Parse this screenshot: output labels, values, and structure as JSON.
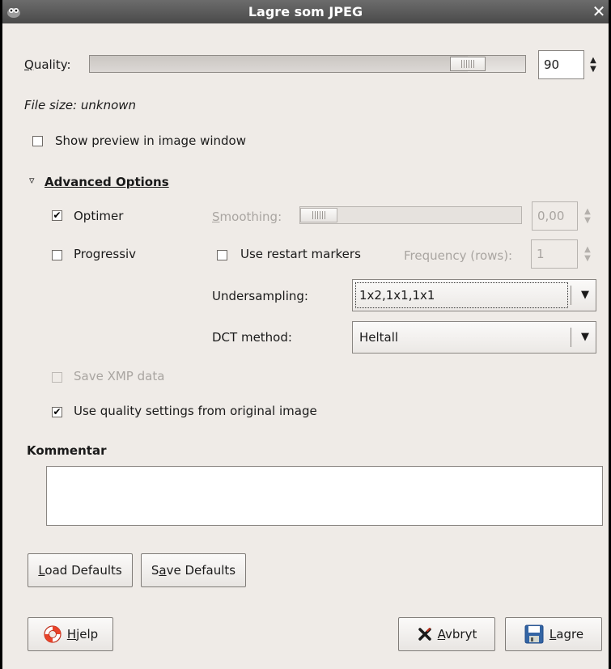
{
  "window": {
    "title": "Lagre som JPEG",
    "close_glyph": "✕"
  },
  "quality": {
    "label_accel": "Q",
    "label_rest": "uality:",
    "value": "90",
    "slider_fraction": 0.9
  },
  "file_size": "File size: unknown",
  "show_preview": {
    "label": "Show preview in image window",
    "checked": false
  },
  "advanced": {
    "expander_glyph": "▿",
    "label_accel": "A",
    "label_rest": "dvanced Options",
    "optimize": {
      "label": "Optimer",
      "checked": true
    },
    "smoothing": {
      "label_accel": "S",
      "label_rest": "moothing:",
      "value": "0,00",
      "slider_fraction": 0.0
    },
    "progressive": {
      "label": "Progressiv",
      "checked": false
    },
    "restart_markers": {
      "label": "Use restart markers",
      "checked": false
    },
    "frequency": {
      "label": "Frequency (rows):",
      "value": "1"
    },
    "undersampling": {
      "label": "Undersampling:",
      "value": "1x2,1x1,1x1"
    },
    "dct": {
      "label": "DCT method:",
      "value": "Heltall"
    },
    "save_xmp": {
      "label": "Save XMP data",
      "checked": false
    },
    "use_quality": {
      "label": "Use quality settings from original image",
      "checked": true
    }
  },
  "comment": {
    "heading": "Kommentar",
    "value": ""
  },
  "buttons": {
    "load_defaults_accel": "L",
    "load_defaults_rest": "oad Defaults",
    "save_defaults_pre": "S",
    "save_defaults_accel": "a",
    "save_defaults_rest": "ve Defaults",
    "help_accel": "H",
    "help_rest": "jelp",
    "cancel_accel": "A",
    "cancel_rest": "vbryt",
    "save_accel": "L",
    "save_rest": "agre"
  },
  "icons": {
    "help": "lifebuoy-icon",
    "cancel": "cancel-x-icon",
    "save": "floppy-disk-icon",
    "app": "gimp-icon"
  },
  "colors": {
    "titlebar": "#595959",
    "dialog_bg": "#efebe7",
    "help_icon": "#e8432a",
    "save_icon": "#3465a4"
  }
}
